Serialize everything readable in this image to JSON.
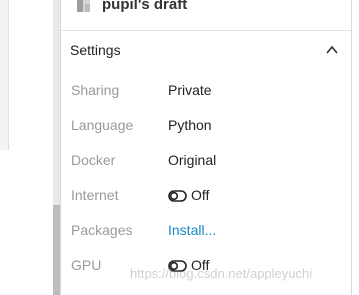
{
  "draft": {
    "title": "pupil's draft",
    "icon": "draft-file-icon"
  },
  "settings": {
    "title": "Settings",
    "collapse_icon": "chevron-up-icon",
    "rows": [
      {
        "label": "Sharing",
        "value": "Private"
      },
      {
        "label": "Language",
        "value": "Python"
      },
      {
        "label": "Docker",
        "value": "Original"
      },
      {
        "label": "Internet",
        "value": "Off",
        "toggle_icon": "toggle-off-icon"
      },
      {
        "label": "Packages",
        "value": "Install...",
        "link": true
      },
      {
        "label": "GPU",
        "value": "Off",
        "toggle_icon": "toggle-off-icon"
      }
    ]
  },
  "colors": {
    "label": "#9a9a9a",
    "value": "#222222",
    "link": "#1a88c9"
  },
  "watermark": "https://blog.csdn.net/appleyuchi"
}
